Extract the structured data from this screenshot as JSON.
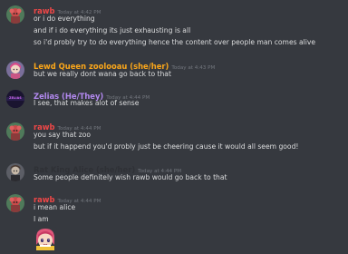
{
  "colors": {
    "background": "#36393f",
    "text": "#dcddde",
    "timestamp": "#72767d",
    "rawb": "#f04747",
    "lewd_queen": "#faa61a",
    "zelias": "#b389f0",
    "rat_king": "#2f3136"
  },
  "messages": [
    {
      "username": "rawb",
      "timestamp": "Today at 4:42 PM",
      "lines": [
        "or i do everything",
        "and if i do everything its just exhausting is all",
        "so i'd probly try to do everything hence the content over people man comes alive"
      ]
    },
    {
      "username": "Lewd Queen zoolooau (she/her)",
      "timestamp": "Today at 4:43 PM",
      "lines": [
        "but we really dont wana go back to that"
      ]
    },
    {
      "username": "Zelias (He/They)",
      "timestamp": "Today at 4:44 PM",
      "avatar_text": "ZELIAS",
      "lines": [
        "I see, that makes alot of sense"
      ]
    },
    {
      "username": "rawb",
      "timestamp": "Today at 4:44 PM",
      "lines": [
        "you say that zoo",
        "but if it happend you'd probly just be cheering cause it would all seem good!"
      ]
    },
    {
      "username": "Rat King Alice (she/her)",
      "timestamp": "Today at 4:44 PM",
      "lines": [
        "Some people definitely wish rawb would go back to that"
      ]
    },
    {
      "username": "rawb",
      "timestamp": "Today at 4:44 PM",
      "lines": [
        "i mean alice",
        "I am"
      ],
      "attachment": "anime-girl-emoji"
    }
  ]
}
